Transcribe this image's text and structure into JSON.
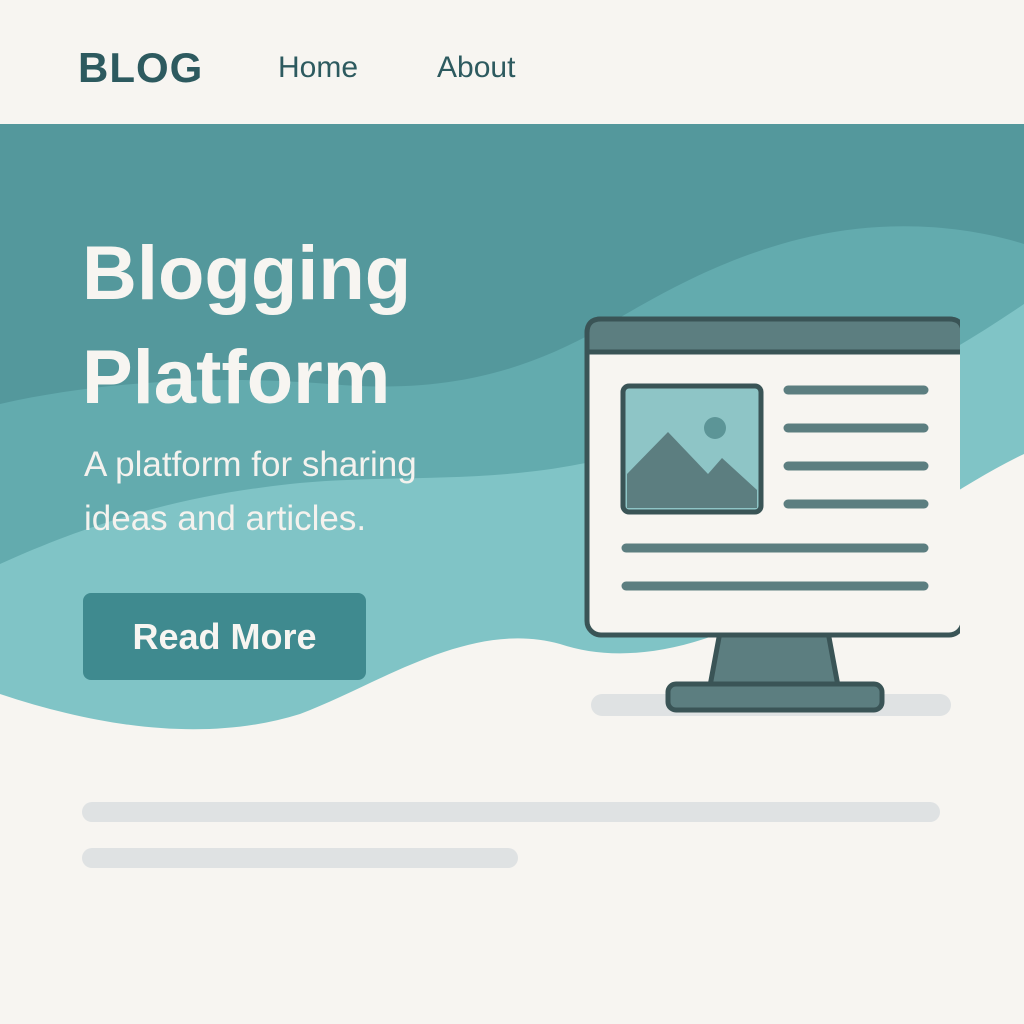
{
  "header": {
    "logo": "BLOG",
    "nav": [
      {
        "label": "Home"
      },
      {
        "label": "About"
      }
    ]
  },
  "hero": {
    "title_line1": "Blogging",
    "title_line2": "Platform",
    "subtitle": "A platform for sharing ideas and articles.",
    "cta_label": "Read More"
  },
  "illustration": {
    "icon": "monitor-blog-page-icon",
    "image_icon": "mountain-image-icon"
  },
  "colors": {
    "background": "#f7f5f1",
    "hero_dark": "#54989c",
    "hero_mid": "#63abae",
    "hero_light": "#80c4c6",
    "button": "#3f8a8f",
    "text_dark": "#2d5a5f",
    "monitor_outline": "#3a5456",
    "placeholder": "#dfe2e3"
  }
}
